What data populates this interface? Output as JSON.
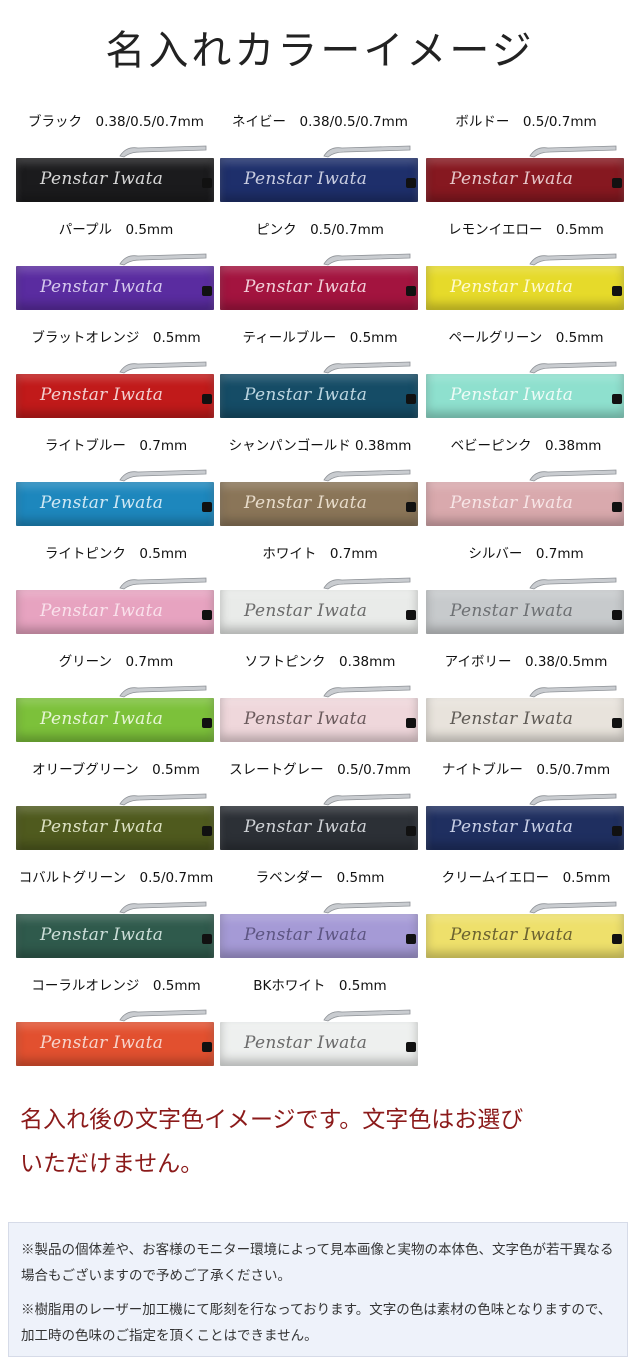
{
  "title": "名入れカラーイメージ",
  "engraving_text": "Penstar Iwata",
  "colors": [
    {
      "label": "ブラック　0.38/0.5/0.7mm",
      "body": "#1b1b1d",
      "text": "#d8d8d8"
    },
    {
      "label": "ネイビー　0.38/0.5/0.7mm",
      "body": "#1e2f6b",
      "text": "#c9cde0"
    },
    {
      "label": "ボルドー　0.5/0.7mm",
      "body": "#861820",
      "text": "#e6c7c9"
    },
    {
      "label": "パープル　0.5mm",
      "body": "#5a2ca0",
      "text": "#d6c9ee"
    },
    {
      "label": "ピンク　0.5/0.7mm",
      "body": "#a3143f",
      "text": "#f1cfd9"
    },
    {
      "label": "レモンイエロー　0.5mm",
      "body": "#e6da2a",
      "text": "#fffbd0"
    },
    {
      "label": "ブラットオレンジ　0.5mm",
      "body": "#c11a1a",
      "text": "#f3d0d0"
    },
    {
      "label": "ティールブルー　0.5mm",
      "body": "#154c66",
      "text": "#bdd6e1"
    },
    {
      "label": "ペールグリーン　0.5mm",
      "body": "#8ee0ce",
      "text": "#eefbf7"
    },
    {
      "label": "ライトブルー　0.7mm",
      "body": "#1d87bd",
      "text": "#d0e8f4"
    },
    {
      "label": "シャンパンゴールド 0.38mm",
      "body": "#8a7558",
      "text": "#e8dccb"
    },
    {
      "label": "ベビーピンク　0.38mm",
      "body": "#d9a9ad",
      "text": "#f7e5e6"
    },
    {
      "label": "ライトピンク　0.5mm",
      "body": "#e7a3c0",
      "text": "#f9e1eb"
    },
    {
      "label": "ホワイト　0.7mm",
      "body": "#e9ebe9",
      "text": "#6b6b6b"
    },
    {
      "label": "シルバー　0.7mm",
      "body": "#c7cacc",
      "text": "#6d7073"
    },
    {
      "label": "グリーン　0.7mm",
      "body": "#7cc13a",
      "text": "#e7f5d6"
    },
    {
      "label": "ソフトピンク　0.38mm",
      "body": "#efd7db",
      "text": "#6a5a5c"
    },
    {
      "label": "アイボリー　0.38/0.5mm",
      "body": "#e8e3dc",
      "text": "#5e5a55"
    },
    {
      "label": "オリーブグリーン　0.5mm",
      "body": "#4f5a1e",
      "text": "#dde2c3"
    },
    {
      "label": "スレートグレー　0.5/0.7mm",
      "body": "#2c3036",
      "text": "#cfd2d6"
    },
    {
      "label": "ナイトブルー　0.5/0.7mm",
      "body": "#1f2f60",
      "text": "#c9d0e6"
    },
    {
      "label": "コバルトグリーン　0.5/0.7mm",
      "body": "#2f5a4c",
      "text": "#cddfd9"
    },
    {
      "label": "ラベンダー　0.5mm",
      "body": "#a59ad6",
      "text": "#5d5582"
    },
    {
      "label": "クリームイエロー　0.5mm",
      "body": "#eee06b",
      "text": "#6b6230"
    },
    {
      "label": "コーラルオレンジ　0.5mm",
      "body": "#e2502f",
      "text": "#f7d4cb"
    },
    {
      "label": "BKホワイト　0.5mm",
      "body": "#eef0ef",
      "text": "#6a6a6a"
    }
  ],
  "notice_line1": "名入れ後の文字色イメージです。文字色はお選び",
  "notice_line2": "いただけません。",
  "footnote1": "※製品の個体差や、お客様のモニター環境によって見本画像と実物の本体色、文字色が若干異なる場合もございますので予めご了承ください。",
  "footnote2": "※樹脂用のレーザー加工機にて彫刻を行なっております。文字の色は素材の色味となりますので、加工時の色味のご指定を頂くことはできません。"
}
